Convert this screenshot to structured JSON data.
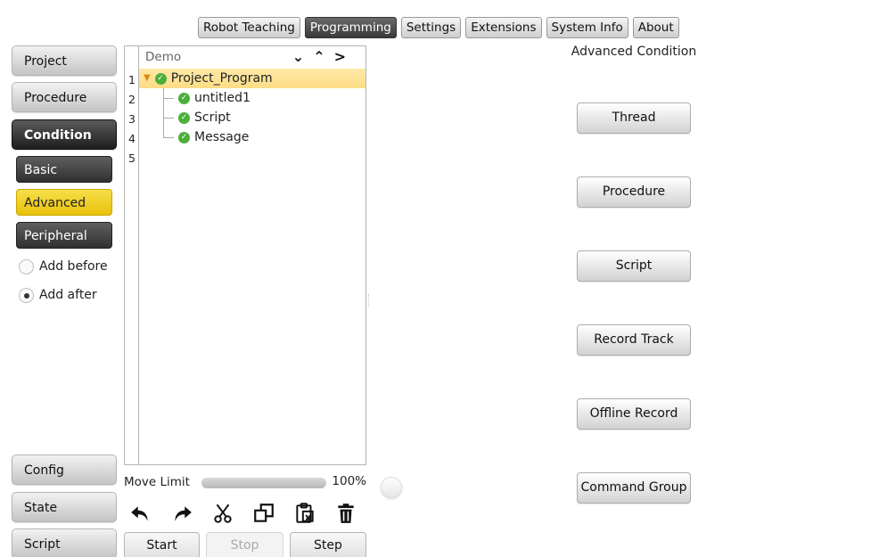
{
  "top_tabs": [
    {
      "label": "Robot Teaching",
      "active": false
    },
    {
      "label": "Programming",
      "active": true
    },
    {
      "label": "Settings",
      "active": false
    },
    {
      "label": "Extensions",
      "active": false
    },
    {
      "label": "System Info",
      "active": false
    },
    {
      "label": "About",
      "active": false
    }
  ],
  "left_nav": {
    "project": "Project",
    "procedure": "Procedure",
    "condition": "Condition",
    "config": "Config",
    "state": "State",
    "script": "Script"
  },
  "condition_sub": {
    "basic": "Basic",
    "advanced": "Advanced",
    "peripheral": "Peripheral"
  },
  "insert_mode": {
    "add_before": "Add before",
    "add_after": "Add after",
    "selected": "add_after"
  },
  "tree": {
    "header": "Demo",
    "line_numbers": [
      "1",
      "2",
      "3",
      "4",
      "5"
    ],
    "root": "Project_Program",
    "children": [
      "untitled1",
      "Script",
      "Message"
    ]
  },
  "move_limit": {
    "label": "Move Limit",
    "value_text": "100%",
    "value": 100
  },
  "edit_icons": [
    "undo-icon",
    "redo-icon",
    "cut-icon",
    "copy-icon",
    "paste-icon",
    "delete-icon"
  ],
  "run": {
    "start": "Start",
    "stop": "Stop",
    "step": "Step"
  },
  "right_panel": {
    "title": "Advanced Condition",
    "buttons": [
      "Thread",
      "Procedure",
      "Script",
      "Record Track",
      "Offline Record",
      "Command Group"
    ]
  },
  "colors": {
    "accent_yellow": "#f2d22e",
    "selection": "#fde29a",
    "check_green": "#4caf3b",
    "dark_button": "#3a3a3a"
  }
}
